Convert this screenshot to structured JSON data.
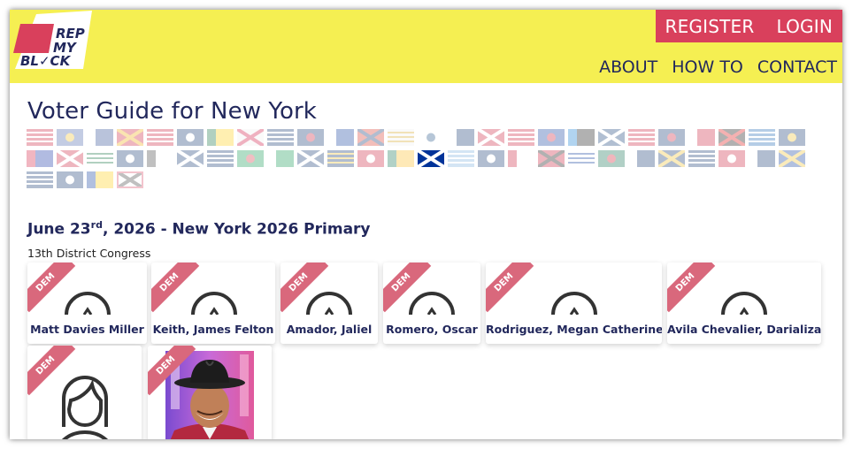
{
  "brand": {
    "logo_line1": "REP",
    "logo_line2": "MY",
    "logo_line3": "BL✓CK",
    "colors": {
      "yellow": "#f5ef52",
      "red": "#d9405c",
      "navy": "#22285c",
      "ribbon": "#d9687c"
    }
  },
  "nav": {
    "register": "REGISTER",
    "login": "LOGIN",
    "about": "ABOUT",
    "how_to": "HOW TO",
    "contact": "CONTACT"
  },
  "page": {
    "title": "Voter Guide for New York"
  },
  "state_flags": {
    "count": 56,
    "selected": "New York"
  },
  "election": {
    "date_prefix": "June 23",
    "date_suffix": "rd",
    "date_rest": ", 2026 - New York 2026 Primary",
    "office": "13th District Congress"
  },
  "candidates": [
    {
      "name": "Matt Davies Miller",
      "party": "DEM"
    },
    {
      "name": "Keith, James Felton",
      "party": "DEM"
    },
    {
      "name": "Amador, Jaliel",
      "party": "DEM"
    },
    {
      "name": "Romero, Oscar",
      "party": "DEM"
    },
    {
      "name": "Rodriguez, Megan Catherine",
      "party": "DEM"
    },
    {
      "name": "Avila Chevalier, Darializa",
      "party": "DEM"
    },
    {
      "name": "",
      "party": "DEM"
    },
    {
      "name": "",
      "party": "DEM"
    }
  ]
}
